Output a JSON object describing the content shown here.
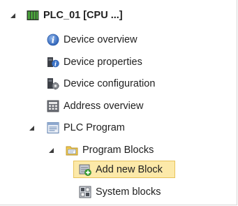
{
  "tree": {
    "root": {
      "label": "PLC_01 [CPU ...]",
      "icon": "plc-device-icon"
    },
    "items": [
      {
        "label": "Device overview",
        "icon": "info-circle-icon"
      },
      {
        "label": "Device properties",
        "icon": "device-properties-icon"
      },
      {
        "label": "Device configuration",
        "icon": "device-configuration-icon"
      },
      {
        "label": "Address overview",
        "icon": "address-overview-icon"
      }
    ],
    "plc_program": {
      "label": "PLC Program",
      "icon": "plc-program-icon",
      "program_blocks": {
        "label": "Program Blocks",
        "icon": "folder-icon",
        "children": [
          {
            "label": "Add new Block",
            "icon": "add-block-icon",
            "selected": true
          },
          {
            "label": "System blocks",
            "icon": "system-blocks-icon"
          }
        ]
      }
    }
  },
  "colors": {
    "selection_fill": "#fce9a9",
    "selection_border": "#e8c35a",
    "info_blue": "#3b73c8",
    "folder_yellow": "#f2c94c",
    "add_green": "#3aa535"
  }
}
